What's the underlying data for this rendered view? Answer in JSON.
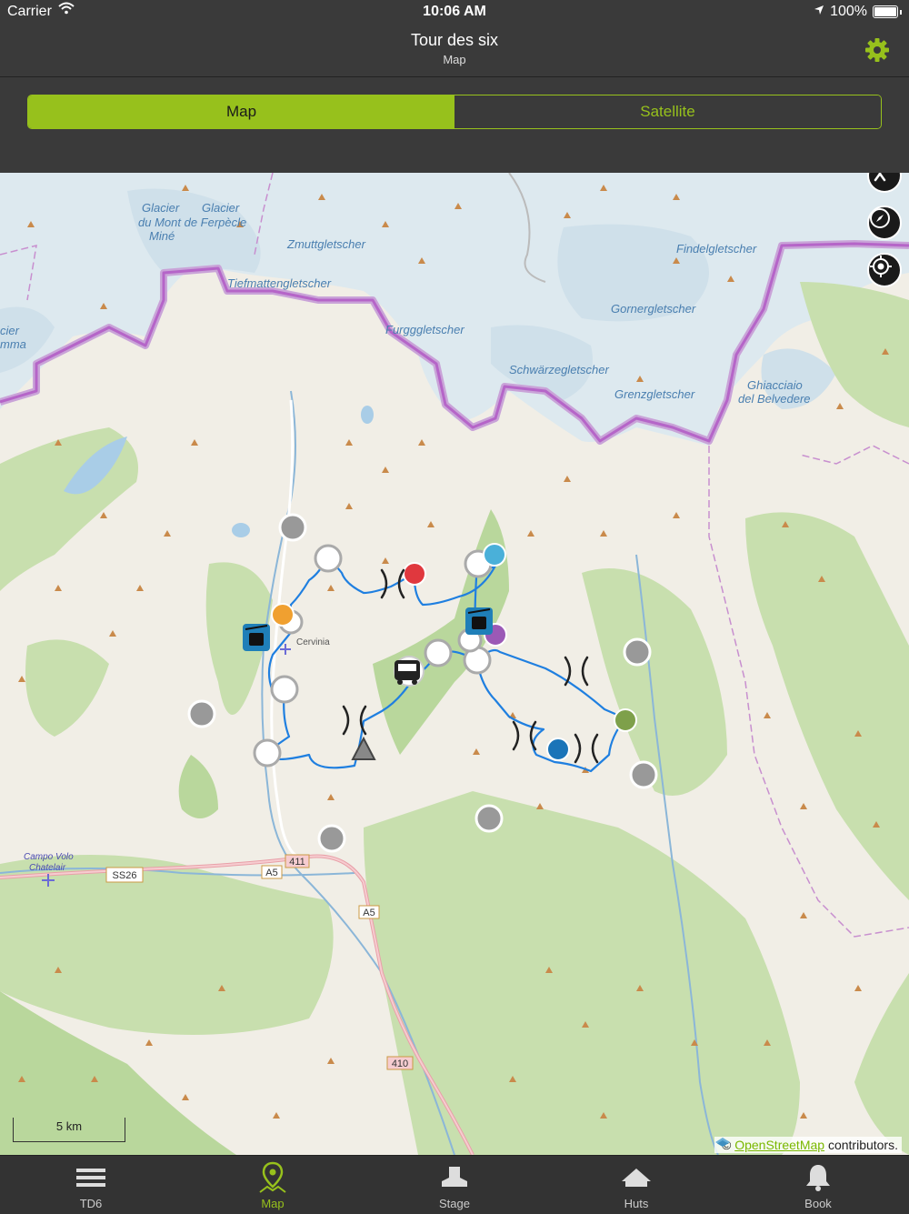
{
  "status_bar": {
    "carrier": "Carrier",
    "time": "10:06 AM",
    "battery": "100%"
  },
  "header": {
    "title": "Tour des six",
    "subtitle": "Map",
    "settings_icon": "gear-icon"
  },
  "segmented": {
    "options": [
      "Map",
      "Satellite"
    ],
    "selected": "Map"
  },
  "map": {
    "labels": {
      "glacier_mont_ferpecle_1": "Glacier",
      "glacier_mont_ferpecle_2": "Glacier",
      "glacier_mont_ferpecle_3": "du Mont de Ferpècle",
      "glacier_mont_ferpecle_4": "Miné",
      "zmutt": "Zmuttgletscher",
      "tiefmatten": "Tiefmattengletscher",
      "furgg": "Furgggletscher",
      "findel": "Findelgletscher",
      "gorner": "Gornergletscher",
      "schwarze": "Schwärzegletscher",
      "grenz": "Grenzgletscher",
      "belvedere_1": "Ghiacciaio",
      "belvedere_2": "del Belvedere",
      "cier": "cier",
      "mma": "mma",
      "campo_volo_1": "Campo Volo",
      "campo_volo_2": "Chatelair",
      "ss26": "SS26",
      "a5a": "A5",
      "a5b": "A5",
      "r411": "411",
      "r410": "410",
      "cervinia": "Cervinia"
    },
    "scale_label": "5 km",
    "attribution": {
      "symbol": "©",
      "link": "OpenStreetMap",
      "suffix": "contributors."
    },
    "controls": [
      "accessibility-icon",
      "compass-icon",
      "locate-icon"
    ]
  },
  "tabs": [
    {
      "label": "TD6",
      "icon": "menu-icon"
    },
    {
      "label": "Map",
      "icon": "map-pin-icon",
      "active": true
    },
    {
      "label": "Stage",
      "icon": "boot-icon"
    },
    {
      "label": "Huts",
      "icon": "hut-icon"
    },
    {
      "label": "Book",
      "icon": "bell-icon"
    }
  ],
  "colors": {
    "accent": "#97c11c",
    "route": "#1f7fe0",
    "border": "#b565c8"
  }
}
